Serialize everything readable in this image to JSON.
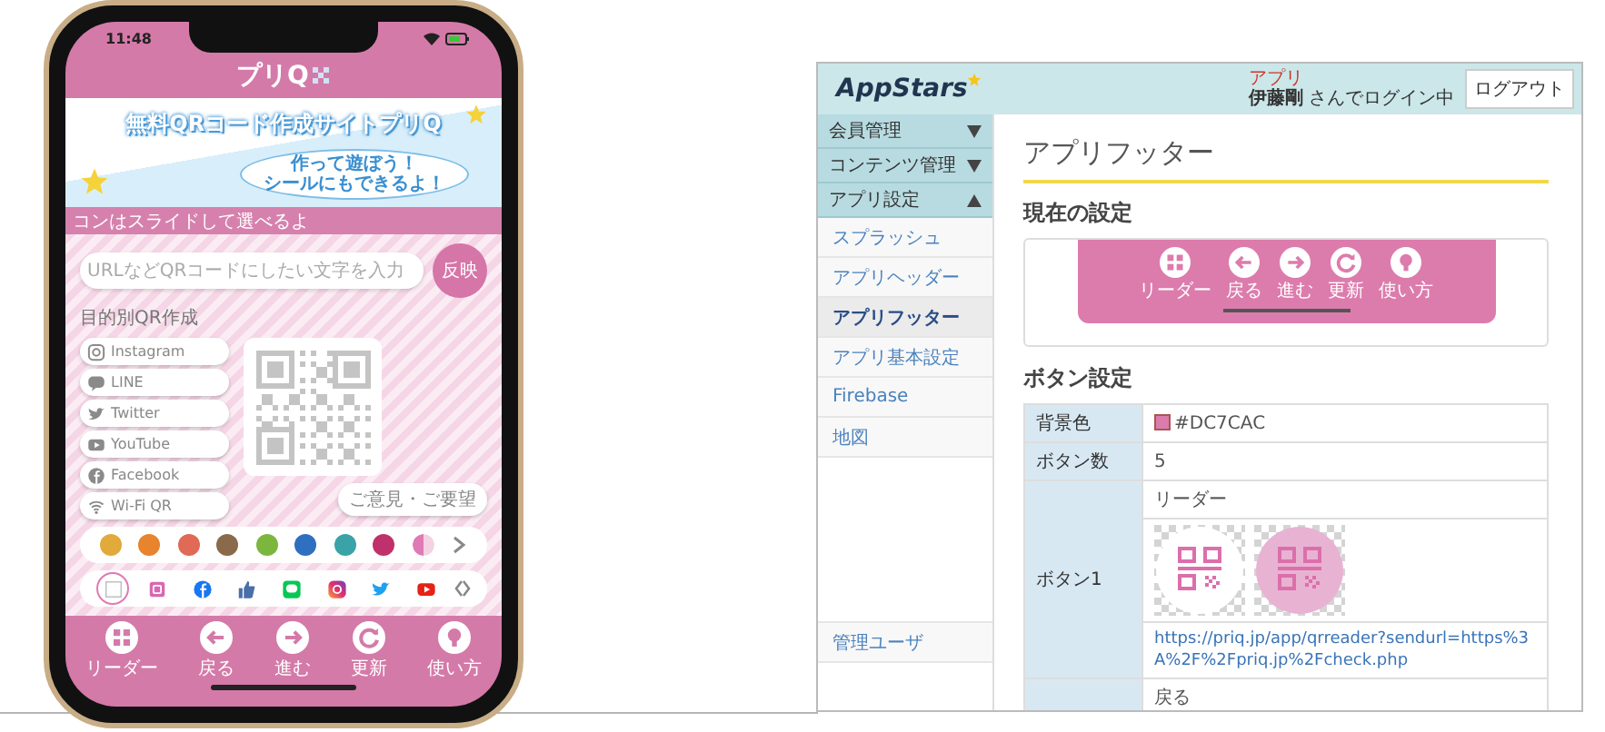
{
  "phone": {
    "status_bar": {
      "time": "11:48"
    },
    "logo": "プリQ",
    "banner": {
      "title": "無料QRコード作成サイトプリQ",
      "bubble": [
        "作って遊ぼう！",
        "シールにもできるよ！"
      ]
    },
    "hint": "コンはスライドして選べるよ",
    "input": {
      "placeholder": "URLなどQRコードにしたい文字を入力"
    },
    "apply_button": "反映",
    "section_label": "目的別QR作成",
    "qr_types": [
      "Instagram",
      "LINE",
      "Twitter",
      "YouTube",
      "Facebook",
      "Wi-Fi QR"
    ],
    "feedback_button": "ご意見・ご要望",
    "colors": [
      {
        "color": "#e2a93b"
      },
      {
        "color": "#e8832e"
      },
      {
        "color": "#e06a55"
      },
      {
        "color": "#8a6a4a"
      },
      {
        "color": "#7cb63f"
      },
      {
        "color": "#2f6fc0"
      },
      {
        "color": "#3aa3a8"
      },
      {
        "color": "#c0306a"
      }
    ],
    "icon_choices": [
      {
        "selected": true
      },
      {
        "selected": false
      },
      {
        "selected": false
      },
      {
        "selected": false
      },
      {
        "selected": false
      },
      {
        "selected": false
      },
      {
        "selected": false
      },
      {
        "selected": false
      }
    ],
    "footer": [
      "リーダー",
      "戻る",
      "進む",
      "更新",
      "使い方"
    ]
  },
  "admin": {
    "logo": "AppStars",
    "user": {
      "role": "アプリ",
      "login": "**伊藤剛** さんでログイン中"
    },
    "logout": "ログアウト",
    "sidebar": {
      "groups": [
        {
          "label": "会員管理",
          "expanded": false
        },
        {
          "label": "コンテンツ管理",
          "expanded": false
        },
        {
          "label": "アプリ設定",
          "expanded": true,
          "children": [
            {
              "label": "スプラッシュ",
              "selected": false
            },
            {
              "label": "アプリヘッダー",
              "selected": false
            },
            {
              "label": "アプリフッター",
              "selected": true
            },
            {
              "label": "アプリ基本設定",
              "selected": false
            },
            {
              "label": "Firebase",
              "selected": false
            },
            {
              "label": "地図",
              "selected": false
            }
          ]
        }
      ],
      "bottom_items": [
        {
          "label": "管理ユーザ",
          "selected": false
        }
      ]
    },
    "page_title": "アプリフッター",
    "current_heading": "現在の設定",
    "preview_buttons": [
      "リーダー",
      "戻る",
      "進む",
      "更新",
      "使い方"
    ],
    "settings_heading": "ボタン設定",
    "table": {
      "background_color": {
        "label": "背景色",
        "value": "#DC7CAC",
        "color": "#dc7cac"
      },
      "button_count": {
        "label": "ボタン数",
        "value": "5"
      },
      "buttons": [
        {
          "label": "ボタン1",
          "name": "リーダー",
          "images": true,
          "link": "https://priq.jp/app/qrreader?sendurl=https%3A%2F%2Fpriq.jp%2Fcheck.php"
        },
        {
          "name": "戻る"
        }
      ]
    }
  }
}
